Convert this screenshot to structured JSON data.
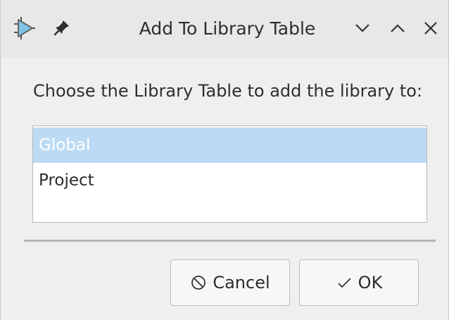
{
  "window": {
    "title": "Add To Library Table",
    "icons": {
      "app": "kicad-app-icon",
      "pin": "pin-icon",
      "minimize": "chevron-down-icon",
      "maximize": "chevron-up-icon",
      "close": "close-icon"
    }
  },
  "dialog": {
    "prompt": "Choose the Library Table to add the library to:",
    "options": [
      {
        "label": "Global",
        "selected": true
      },
      {
        "label": "Project",
        "selected": false
      }
    ],
    "buttons": {
      "cancel_label": "Cancel",
      "cancel_icon": "cancel-icon",
      "ok_label": "OK",
      "ok_icon": "check-icon"
    }
  },
  "colors": {
    "selection": "#bcdaf3",
    "window_bg": "#efefef",
    "titlebar_bg": "#e8e8e8"
  }
}
